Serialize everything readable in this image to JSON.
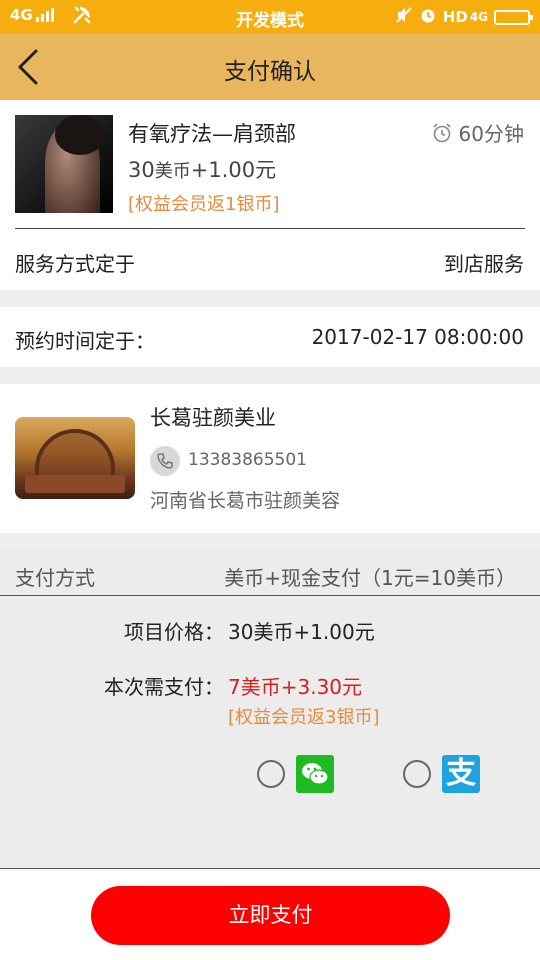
{
  "status_bar": {
    "network": "4G",
    "title": "开发模式",
    "hd": "HD",
    "hd_network": "4G"
  },
  "nav": {
    "title": "支付确认",
    "back_icon": "chevron-left-icon"
  },
  "product": {
    "title": "有氧疗法—肩颈部",
    "price_number": "30",
    "price_unit": "美币",
    "price_extra": "+1.00元",
    "bonus": "[权益会员返1银币]",
    "duration": "60分钟",
    "duration_icon": "alarm-clock-icon",
    "service_label": "服务方式定于",
    "service_value": "到店服务"
  },
  "appointment": {
    "label": "预约时间定于：",
    "value": "2017-02-17 08:00:00"
  },
  "shop": {
    "name": "长葛驻颜美业",
    "phone": "13383865501",
    "address": "河南省长葛市驻颜美容",
    "phone_icon": "phone-icon"
  },
  "payment": {
    "method_label": "支付方式",
    "method_value": "美币+现金支付（1元=10美币）",
    "item_price_label": "项目价格：",
    "item_price_value": "30美币+1.00元",
    "need_pay_label": "本次需支付：",
    "need_pay_value": "7美币+3.30元",
    "need_pay_bonus": "[权益会员返3银币]",
    "options": [
      {
        "name": "wechat",
        "icon": "wechat-pay-icon",
        "selected": false
      },
      {
        "name": "alipay",
        "icon": "alipay-icon",
        "selected": false
      }
    ],
    "accent_red": "#d81e1e",
    "accent_orange": "#e88a3c"
  },
  "footer": {
    "pay_button": "立即支付",
    "pay_button_color": "#fe0000"
  },
  "colors": {
    "status_bar": "#f5ae0d",
    "nav_bar": "#e8b65c"
  }
}
